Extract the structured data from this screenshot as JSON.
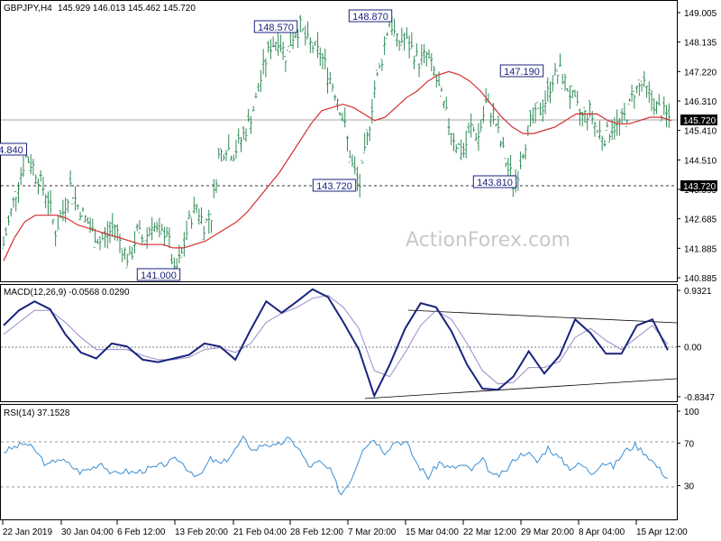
{
  "header": {
    "symbol": "GBPJPY,H4",
    "ohlc": "145.929 146.013 145.462 145.720"
  },
  "watermark": "ActionForex.com",
  "colors": {
    "bar": "#2e8b57",
    "ma": "#d32f2f",
    "macd": "#1a237e",
    "signal": "#9a8ac8",
    "rsi": "#3b8fd4",
    "label_border": "#1a237e",
    "tag_bg": "#000000"
  },
  "chart_data": [
    {
      "type": "line",
      "panel": "price",
      "ylim": [
        140.885,
        149.005
      ],
      "y_ticks": [
        "149.005",
        "148.135",
        "147.220",
        "146.310",
        "145.410",
        "144.510",
        "143.595",
        "142.685",
        "141.885",
        "140.885"
      ],
      "x": [
        "22 Jan 2019",
        "30 Jan 04:00",
        "6 Feb 12:00",
        "13 Feb 20:00",
        "21 Feb 04:00",
        "28 Feb 12:00",
        "7 Mar 20:00",
        "15 Mar 04:00",
        "22 Mar 12:00",
        "29 Mar 20:00",
        "8 Apr 04:00",
        "15 Apr 12:00"
      ],
      "series": [
        {
          "values": [
            141.9,
            142.9,
            143.8,
            144.6,
            144.3,
            143.8,
            143.3,
            142.3,
            142.9,
            143.7,
            143.1,
            142.7,
            142.3,
            142.0,
            142.2,
            142.5,
            141.8,
            141.4,
            142.3,
            142.0,
            142.6,
            142.1,
            142.4,
            141.0,
            141.6,
            142.6,
            143.1,
            142.5,
            142.8,
            144.6,
            144.9,
            144.7,
            145.1,
            145.6,
            146.3,
            147.3,
            148.0,
            148.2,
            147.7,
            148.3,
            148.57,
            148.1,
            147.9,
            147.6,
            147.0,
            146.4,
            145.5,
            144.3,
            143.72,
            145.1,
            146.7,
            147.6,
            148.87,
            148.1,
            148.2,
            147.9,
            147.5,
            147.7,
            147.2,
            146.4,
            145.6,
            145.0,
            144.7,
            145.5,
            145.2,
            146.2,
            145.9,
            145.0,
            144.2,
            143.81,
            144.8,
            145.6,
            145.9,
            146.3,
            147.0,
            147.19,
            146.7,
            146.2,
            145.8,
            146.0,
            145.4,
            145.2,
            145.5,
            145.6,
            145.9,
            146.6,
            146.8,
            146.5,
            146.1,
            145.9,
            145.72
          ]
        },
        {
          "values": [
            141.4,
            142.1,
            142.6,
            142.8,
            142.8,
            142.8,
            142.7,
            142.5,
            142.4,
            142.3,
            142.2,
            142.1,
            142.0,
            141.9,
            141.9,
            141.9,
            141.8,
            141.8,
            141.9,
            142.0,
            142.2,
            142.4,
            142.6,
            142.9,
            143.3,
            143.7,
            144.1,
            144.6,
            145.1,
            145.6,
            146.0,
            146.1,
            146.2,
            146.1,
            145.9,
            145.7,
            145.8,
            146.1,
            146.4,
            146.6,
            146.9,
            147.1,
            147.2,
            147.1,
            146.9,
            146.6,
            146.2,
            145.8,
            145.5,
            145.3,
            145.3,
            145.4,
            145.5,
            145.7,
            145.9,
            145.9,
            145.9,
            145.7,
            145.6,
            145.6,
            145.7,
            145.8,
            145.8,
            145.7
          ]
        }
      ],
      "annotations": [
        "4.840",
        "141.000",
        "148.570",
        "143.720",
        "148.870",
        "143.810",
        "147.190"
      ],
      "tags": [
        "145.720",
        "143.720"
      ]
    },
    {
      "type": "line",
      "panel": "macd",
      "title": "MACD(12,26,9) -0.0568 0.0290",
      "ylim": [
        -0.8347,
        0.9321
      ],
      "y_ticks": [
        "0.9321",
        "0.00",
        "-0.8347"
      ],
      "series": [
        {
          "values": [
            0.35,
            0.6,
            0.75,
            0.62,
            0.2,
            -0.1,
            -0.2,
            0.05,
            0.0,
            -0.22,
            -0.26,
            -0.2,
            -0.14,
            0.05,
            0.0,
            -0.22,
            0.28,
            0.75,
            0.56,
            0.75,
            0.95,
            0.82,
            0.4,
            -0.05,
            -0.82,
            -0.3,
            0.3,
            0.72,
            0.65,
            0.25,
            -0.3,
            -0.7,
            -0.72,
            -0.5,
            -0.08,
            -0.45,
            -0.15,
            0.45,
            0.22,
            -0.12,
            -0.12,
            0.35,
            0.45,
            -0.06
          ]
        },
        {
          "values": [
            0.2,
            0.4,
            0.6,
            0.6,
            0.4,
            0.15,
            -0.05,
            -0.05,
            -0.05,
            -0.15,
            -0.22,
            -0.22,
            -0.18,
            -0.05,
            -0.02,
            -0.1,
            0.05,
            0.4,
            0.55,
            0.65,
            0.8,
            0.85,
            0.65,
            0.3,
            -0.4,
            -0.5,
            -0.1,
            0.35,
            0.6,
            0.45,
            0.05,
            -0.4,
            -0.62,
            -0.6,
            -0.35,
            -0.35,
            -0.25,
            0.15,
            0.3,
            0.1,
            -0.05,
            0.15,
            0.35,
            0.03
          ]
        }
      ]
    },
    {
      "type": "line",
      "panel": "rsi",
      "title": "RSI(14) 37.1528",
      "ylim": [
        0,
        100
      ],
      "y_ticks": [
        "100",
        "70",
        "30"
      ],
      "series": [
        {
          "values": [
            62,
            66,
            70,
            62,
            48,
            56,
            50,
            43,
            46,
            52,
            40,
            44,
            42,
            45,
            47,
            51,
            55,
            45,
            38,
            55,
            50,
            60,
            74,
            63,
            70,
            66,
            74,
            67,
            48,
            52,
            44,
            22,
            38,
            66,
            74,
            62,
            72,
            70,
            50,
            38,
            52,
            46,
            49,
            45,
            54,
            38,
            42,
            56,
            62,
            52,
            66,
            56,
            47,
            50,
            42,
            52,
            48,
            62,
            68,
            60,
            48,
            37
          ]
        }
      ]
    }
  ]
}
